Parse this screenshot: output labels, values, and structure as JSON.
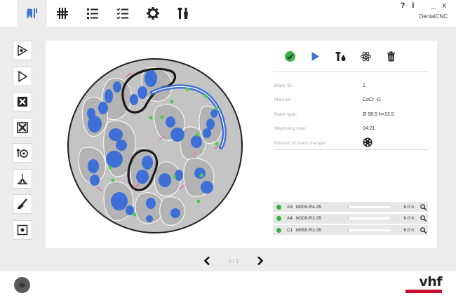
{
  "window": {
    "app_name": "DentalCNC",
    "help": "?",
    "info": "i",
    "minimize": "_",
    "close": "x"
  },
  "tabs": [
    {
      "name": "tab-dental",
      "icon": "tooth-icon",
      "active": true
    },
    {
      "name": "tab-hash",
      "icon": "grid-icon"
    },
    {
      "name": "tab-list",
      "icon": "list-icon"
    },
    {
      "name": "tab-checklist",
      "icon": "checklist-icon"
    },
    {
      "name": "tab-settings",
      "icon": "gear-icon"
    },
    {
      "name": "tab-tools",
      "icon": "tools-icon"
    }
  ],
  "sidebar": [
    "view-icon",
    "play-outline-icon",
    "reject-icon",
    "close-box-icon",
    "rotate-icon",
    "sweep-icon",
    "brush-icon",
    "target-icon"
  ],
  "actions": [
    {
      "icon": "check-circle-icon",
      "color": "#3cb044"
    },
    {
      "icon": "play-icon",
      "color": "#3b74c9"
    },
    {
      "icon": "tool-drop-icon",
      "color": "#222222"
    },
    {
      "icon": "atom-icon",
      "color": "#222222"
    },
    {
      "icon": "trash-icon",
      "color": "#222222"
    }
  ],
  "blank_info": [
    {
      "label": "Blank ID:",
      "value": "1"
    },
    {
      "label": "Material",
      "value": "CoCr -D"
    },
    {
      "label": "Blank type:",
      "value": "Ø 98.5  h=13.5"
    },
    {
      "label": "Machining time:",
      "value": "04:21"
    },
    {
      "label": "Position of blank changer",
      "value": ""
    }
  ],
  "jobs": [
    {
      "shade": "A3",
      "name": "M200-R4-35",
      "time": "8.0 h",
      "status_color": "#3cb044"
    },
    {
      "shade": "A4",
      "name": "M100-R2-35",
      "time": "6.0 h",
      "status_color": "#3cb044"
    },
    {
      "shade": "C1",
      "name": "M060-R2-35",
      "time": "6.0 h",
      "status_color": "#3cb044"
    }
  ],
  "pager": {
    "label": "1 / 1"
  },
  "brand": {
    "logo_text": "vhf",
    "accent": "#c8102e"
  }
}
